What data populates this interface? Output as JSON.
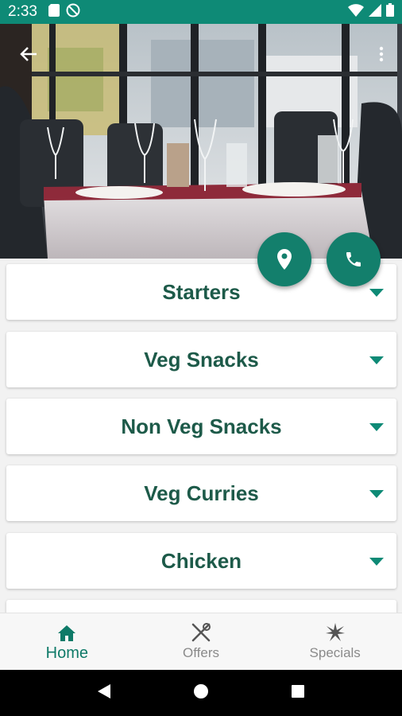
{
  "status_bar": {
    "time": "2:33",
    "icons": [
      "sd-card-icon",
      "do-not-disturb-icon",
      "wifi-icon",
      "signal-icon",
      "battery-icon"
    ]
  },
  "header": {
    "back_icon": "arrow-back-icon",
    "overflow_icon": "more-vert-icon"
  },
  "fabs": [
    {
      "name": "location",
      "icon": "location-pin-icon"
    },
    {
      "name": "call",
      "icon": "phone-icon"
    }
  ],
  "categories": [
    {
      "label": "Starters"
    },
    {
      "label": "Veg Snacks"
    },
    {
      "label": "Non Veg Snacks"
    },
    {
      "label": "Veg Curries"
    },
    {
      "label": "Chicken"
    },
    {
      "label": ""
    }
  ],
  "bottom_nav": {
    "items": [
      {
        "label": "Home",
        "icon": "home-icon",
        "active": true
      },
      {
        "label": "Offers",
        "icon": "fork-knife-icon",
        "active": false
      },
      {
        "label": "Specials",
        "icon": "starburst-icon",
        "active": false
      }
    ]
  },
  "colors": {
    "primary": "#0e8a76",
    "fab": "#137f6c",
    "category_text": "#1d5a49",
    "nav_active": "#0e7a68",
    "nav_inactive": "#8a8a8a"
  },
  "system_nav": [
    "back-triangle-icon",
    "home-circle-icon",
    "recents-square-icon"
  ]
}
